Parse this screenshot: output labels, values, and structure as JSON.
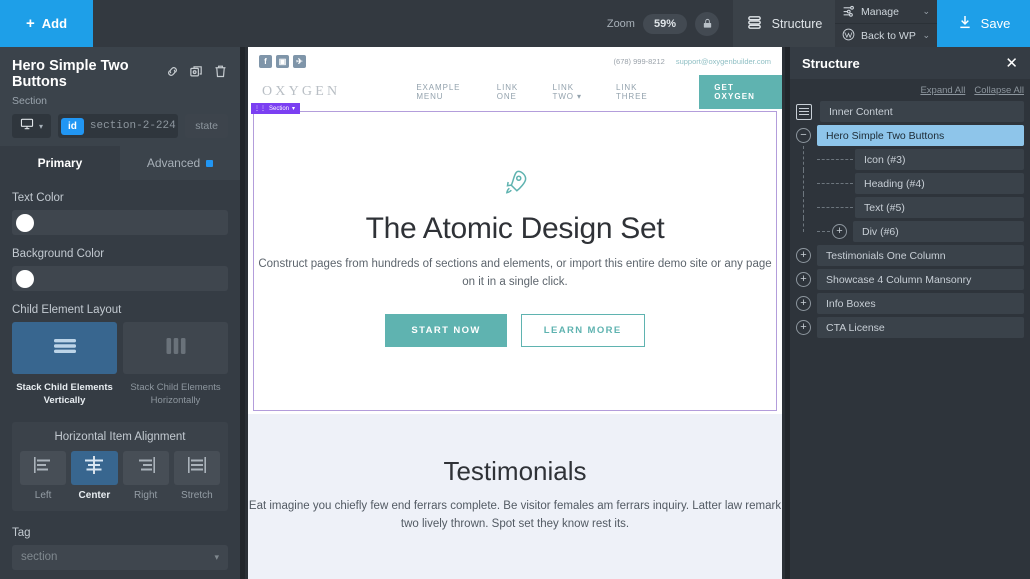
{
  "topbar": {
    "add_label": "Add",
    "add_icon": "plus-icon",
    "zoom_label": "Zoom",
    "zoom_value": "59%",
    "lock_icon": "lock-icon",
    "structure_label": "Structure",
    "structure_icon": "structure-icon",
    "manage_label": "Manage",
    "manage_icon": "sliders-icon",
    "manage_caret": "⌄",
    "back_to_wp_label": "Back to WP",
    "back_to_wp_icon": "wordpress-icon",
    "back_caret": "⌄",
    "save_label": "Save",
    "save_icon": "download-icon",
    "accent_blue": "#1e9fe8"
  },
  "left_panel": {
    "element_title": "Hero Simple Two Buttons",
    "element_type": "Section",
    "icons": [
      "link-icon",
      "duplicate-icon",
      "trash-icon"
    ],
    "device_icon": "monitor-icon",
    "id_tag": "id",
    "id_value": "section-2-224",
    "state_label": "state",
    "tabs": [
      {
        "label": "Primary",
        "active": true
      },
      {
        "label": "Advanced",
        "active": false,
        "has_dot": true
      }
    ],
    "text_color": {
      "label": "Text Color",
      "value": "#ffffff"
    },
    "background_color": {
      "label": "Background Color",
      "value": "#ffffff"
    },
    "child_layout": {
      "label": "Child Element Layout",
      "options": [
        {
          "caption": "Stack Child Elements Vertically",
          "icon": "stack-vertical-icon",
          "selected": true
        },
        {
          "caption": "Stack Child Elements Horizontally",
          "icon": "stack-horizontal-icon",
          "selected": false
        }
      ]
    },
    "horizontal_alignment": {
      "label": "Horizontal Item Alignment",
      "options": [
        {
          "caption": "Left",
          "icon": "align-left-icon",
          "selected": false
        },
        {
          "caption": "Center",
          "icon": "align-center-icon",
          "selected": true
        },
        {
          "caption": "Right",
          "icon": "align-right-icon",
          "selected": false
        },
        {
          "caption": "Stretch",
          "icon": "align-stretch-icon",
          "selected": false
        }
      ]
    },
    "tag": {
      "label": "Tag",
      "value": "section",
      "caret": "▾"
    }
  },
  "canvas": {
    "section_badge": "Section",
    "site_header": {
      "socials": [
        "facebook-icon",
        "instagram-icon",
        "twitter-icon"
      ],
      "social_glyphs": [
        "f",
        "▣",
        "✈"
      ],
      "phone": "(678) 999-8212",
      "email": "support@oxygenbuilder.com",
      "logo": "OXYGEN",
      "nav": [
        "EXAMPLE MENU",
        "LINK ONE",
        "LINK TWO ▾",
        "LINK THREE"
      ],
      "cta": "GET OXYGEN"
    },
    "hero": {
      "icon": "rocket-icon",
      "title": "The Atomic Design Set",
      "subtitle": "Construct pages from hundreds of sections and elements, or import this entire demo site or any page on it in a single click.",
      "primary_button": "START NOW",
      "secondary_button": "LEARN MORE",
      "accent": "#5fb3b0"
    },
    "testimonials": {
      "title": "Testimonials",
      "body": "Eat imagine you chiefly few end ferrars complete. Be visitor females am ferrars inquiry. Latter law remark two lively thrown. Spot set they know rest its."
    }
  },
  "structure": {
    "title": "Structure",
    "close_icon": "close-icon",
    "expand_all": "Expand All",
    "collapse_all": "Collapse All",
    "nodes": [
      {
        "label": "Inner Content",
        "type": "root",
        "icon": "inner-content-icon"
      },
      {
        "label": "Hero Simple Two Buttons",
        "type": "section",
        "selected": true,
        "toggle": "−"
      },
      {
        "label": "Icon (#3)",
        "type": "child"
      },
      {
        "label": "Heading (#4)",
        "type": "child"
      },
      {
        "label": "Text (#5)",
        "type": "child"
      },
      {
        "label": "Div (#6)",
        "type": "child",
        "toggle": "+"
      },
      {
        "label": "Testimonials One Column",
        "type": "section",
        "toggle": "+"
      },
      {
        "label": "Showcase 4 Column Mansonry",
        "type": "section",
        "toggle": "+"
      },
      {
        "label": "Info Boxes",
        "type": "section",
        "toggle": "+"
      },
      {
        "label": "CTA License",
        "type": "section",
        "toggle": "+"
      }
    ]
  }
}
